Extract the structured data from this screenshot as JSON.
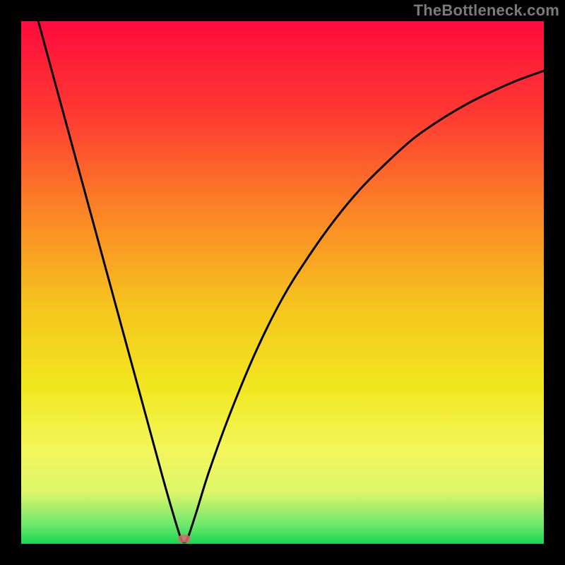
{
  "watermark": "TheBottleneck.com",
  "chart_data": {
    "type": "line",
    "title": "",
    "xlabel": "",
    "ylabel": "",
    "xlim": [
      0,
      100
    ],
    "ylim": [
      0,
      100
    ],
    "grid": false,
    "legend": false,
    "note": "Axes are unlabeled in the source image; x/y domains are normalized 0–100. Main curve has a sharp minimum near x≈31 where bottleneck metric reaches ~0 (optimal). Left branch rises steeply; right branch rises with decreasing slope.",
    "series": [
      {
        "name": "bottleneck-curve",
        "x": [
          0,
          3,
          6,
          9,
          12,
          15,
          18,
          21,
          24,
          27,
          29,
          30.5,
          31.2,
          31.9,
          33.5,
          36,
          40,
          45,
          50,
          55,
          60,
          65,
          70,
          75,
          80,
          85,
          90,
          95,
          100
        ],
        "y": [
          112,
          101,
          90,
          79,
          68,
          57,
          46,
          35,
          24,
          13,
          6,
          1.2,
          0.3,
          1.2,
          6,
          14,
          25,
          37,
          47,
          55,
          62,
          68,
          73,
          77.5,
          81,
          84,
          86.5,
          88.7,
          90.5
        ]
      },
      {
        "name": "optimal-marker",
        "type": "scatter",
        "x": [
          31.2
        ],
        "y": [
          1.0
        ],
        "color": "#d86a6f"
      }
    ],
    "background_gradient": {
      "stops": [
        {
          "pos": 0.0,
          "color": "#ff0b3d"
        },
        {
          "pos": 0.18,
          "color": "#ff3a31"
        },
        {
          "pos": 0.38,
          "color": "#fb8a25"
        },
        {
          "pos": 0.55,
          "color": "#f6c51e"
        },
        {
          "pos": 0.7,
          "color": "#f1e71f"
        },
        {
          "pos": 0.82,
          "color": "#f3f65a"
        },
        {
          "pos": 0.9,
          "color": "#dff66a"
        },
        {
          "pos": 0.965,
          "color": "#6be86d"
        },
        {
          "pos": 1.0,
          "color": "#15d64f"
        }
      ]
    },
    "colors": {
      "curve": "#000000",
      "marker": "#d86a6f",
      "plot_border": "#000000"
    }
  }
}
